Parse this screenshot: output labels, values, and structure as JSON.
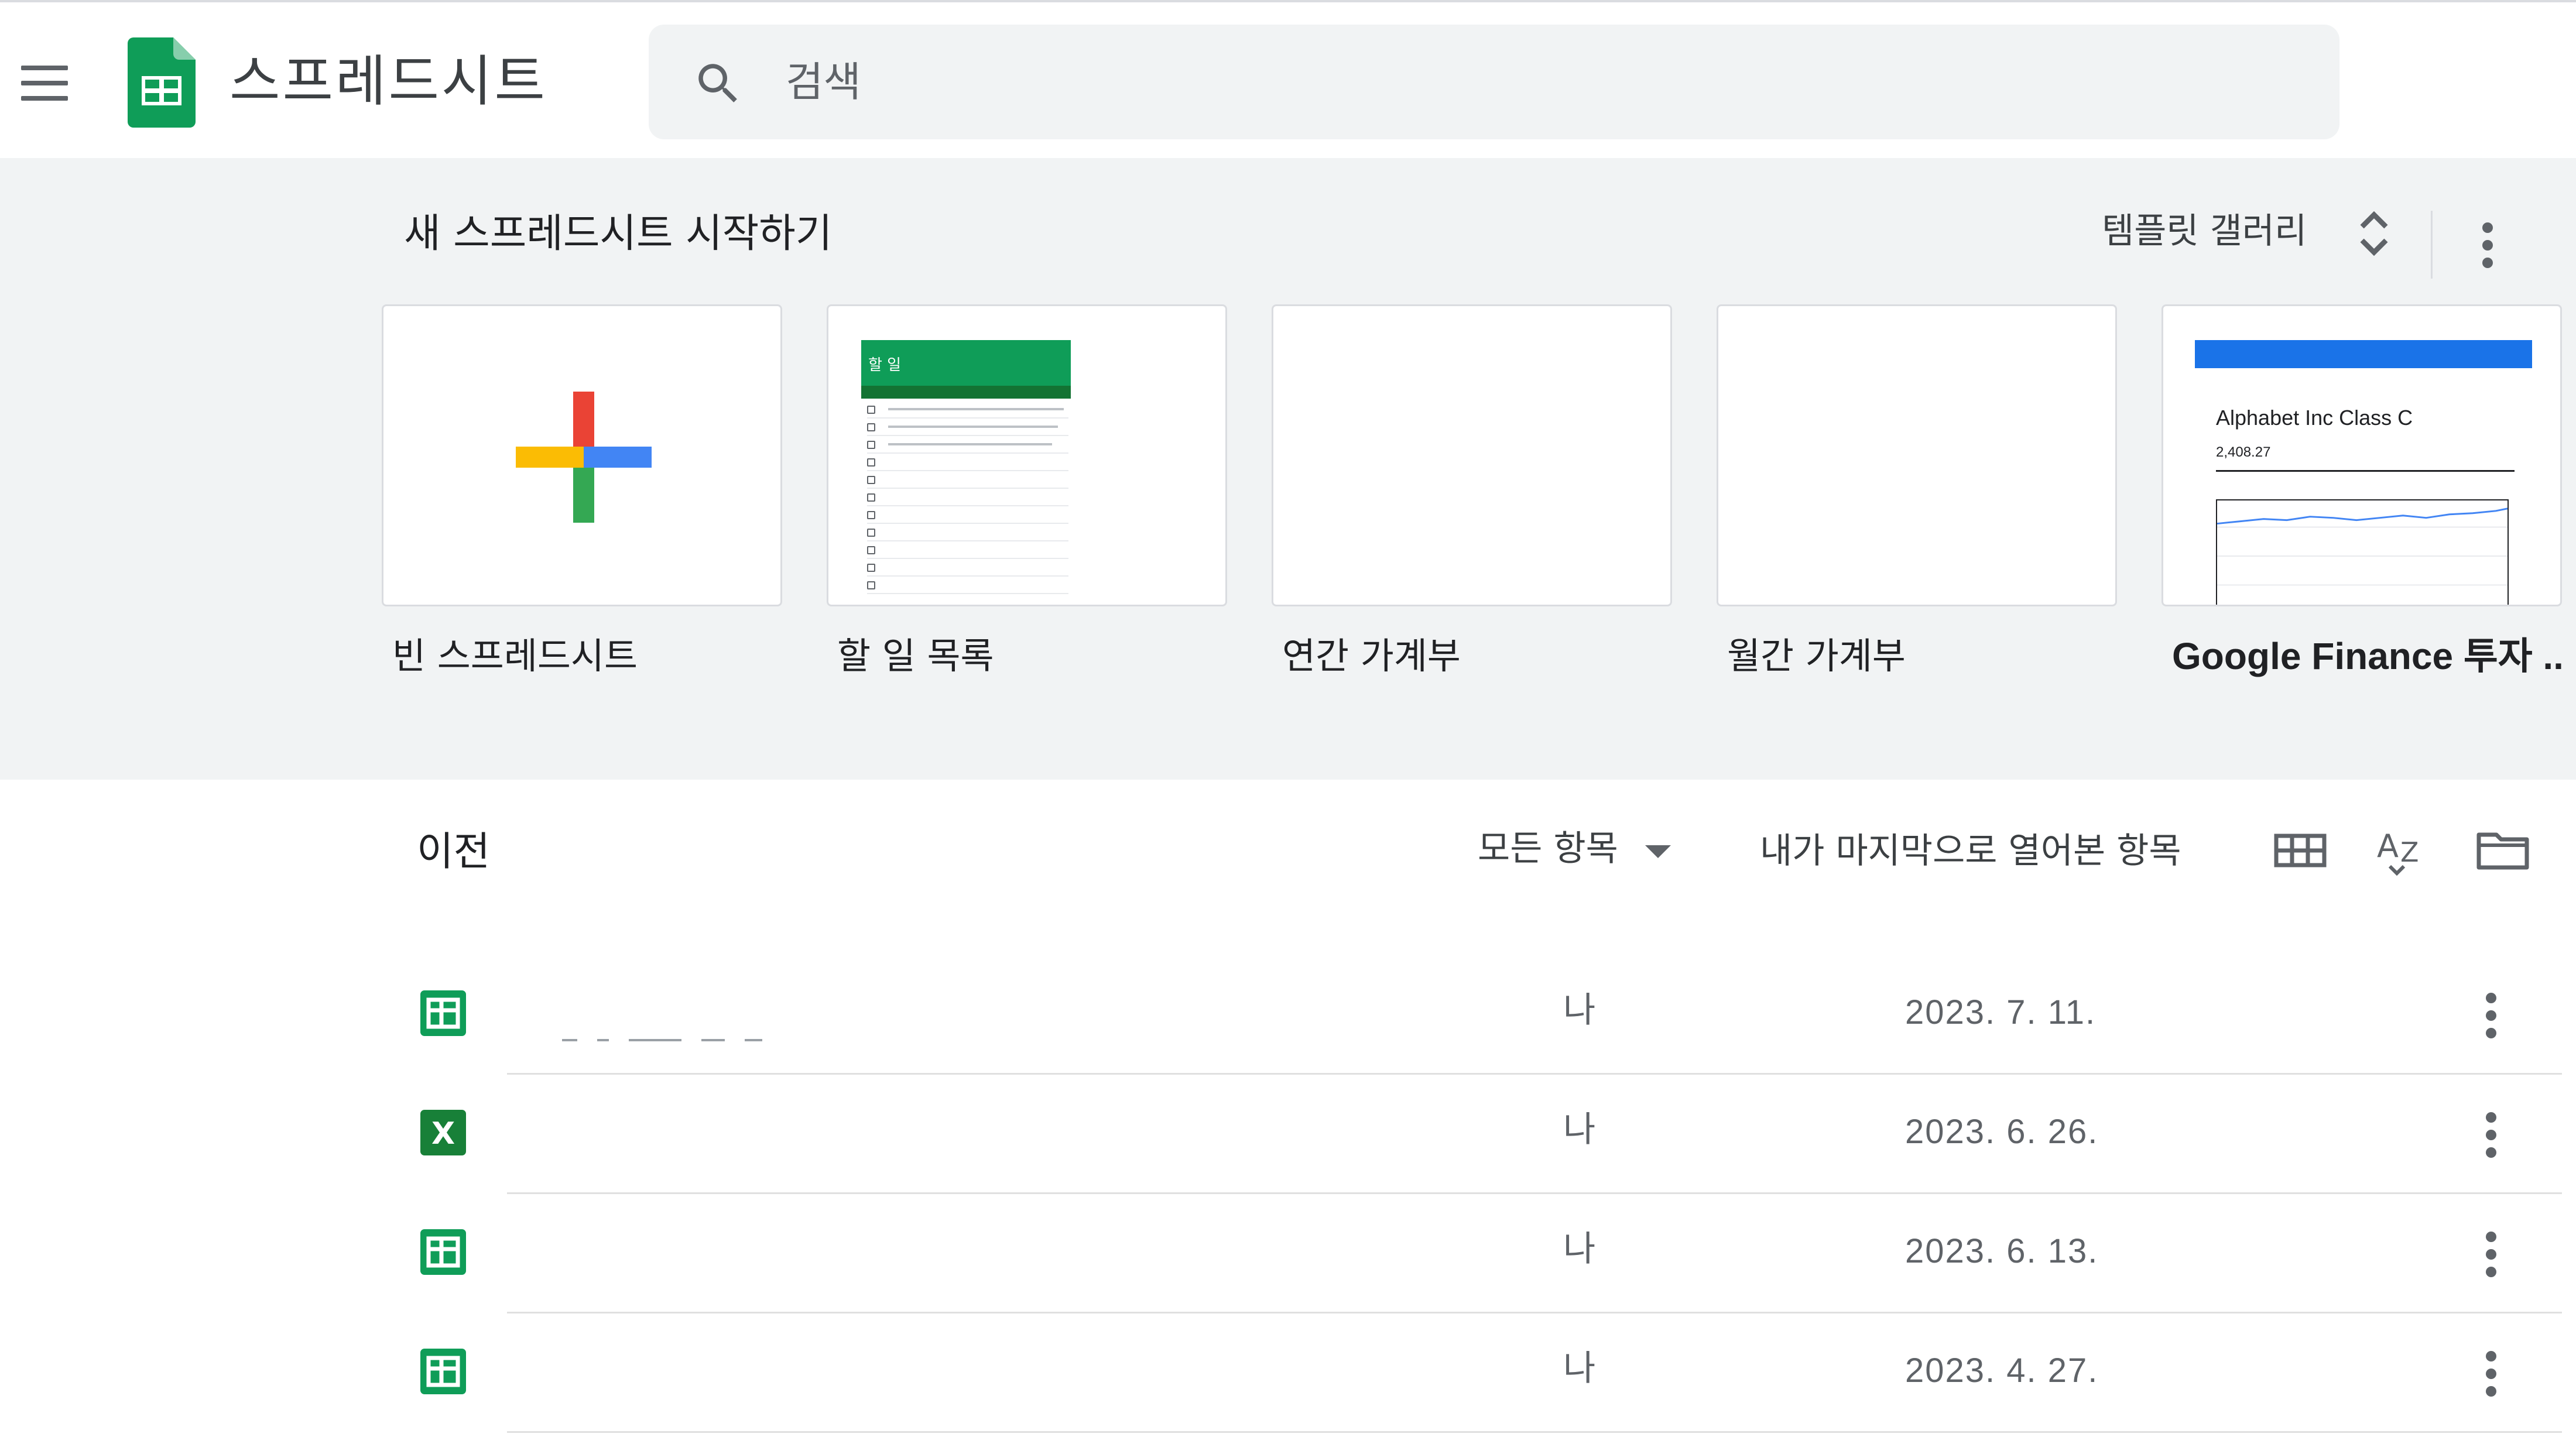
{
  "header": {
    "app_title": "스프레드시트",
    "search": {
      "placeholder": "검색",
      "value": ""
    }
  },
  "templates": {
    "heading": "새 스프레드시트 시작하기",
    "gallery_label": "템플릿 갤러리",
    "items": [
      {
        "label": "빈 스프레드시트"
      },
      {
        "label": "할 일 목록",
        "thumb_title": "할 일"
      },
      {
        "label": "연간 가계부"
      },
      {
        "label": "월간 가계부"
      },
      {
        "label": "Google Finance 투자 ...",
        "thumb_title": "Alphabet Inc Class C",
        "thumb_price": "2,408.27"
      }
    ]
  },
  "recent": {
    "title": "이전",
    "owner_filter": "모든 항목",
    "sort_label": "내가 마지막으로 열어본 항목",
    "files": [
      {
        "type": "sheets",
        "owner": "나",
        "date": "2023. 7. 11."
      },
      {
        "type": "excel",
        "icon_letter": "X",
        "owner": "나",
        "date": "2023. 6. 26."
      },
      {
        "type": "sheets",
        "owner": "나",
        "date": "2023. 6. 13."
      },
      {
        "type": "sheets",
        "owner": "나",
        "date": "2023. 4. 27."
      }
    ]
  },
  "colors": {
    "sheets_green": "#0f9d58",
    "excel_green": "#188038",
    "plus_red": "#ea4335",
    "plus_blue": "#4285f4",
    "plus_yellow": "#fbbc04",
    "plus_green": "#34a853",
    "finance_blue": "#1a73e8"
  }
}
